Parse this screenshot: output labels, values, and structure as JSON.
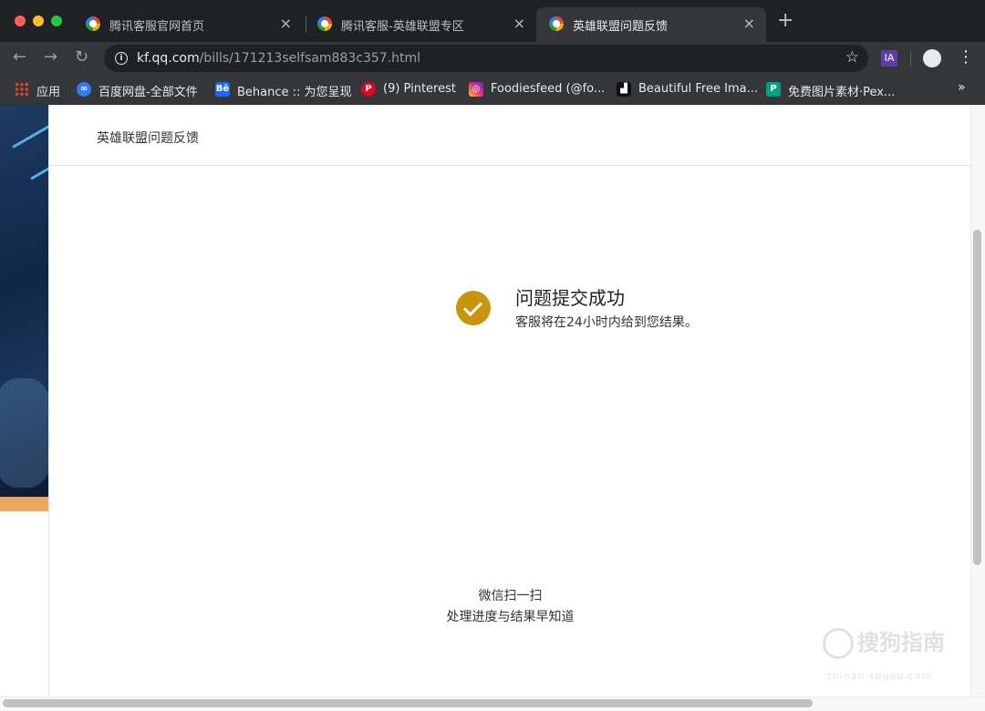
{
  "tabs": [
    {
      "title": "腾讯客服官网首页",
      "active": false
    },
    {
      "title": "腾讯客服-英雄联盟专区",
      "active": false
    },
    {
      "title": "英雄联盟问题反馈",
      "active": true
    }
  ],
  "tab_close_glyph": "×",
  "new_tab_glyph": "+",
  "toolbar": {
    "back_glyph": "←",
    "forward_glyph": "→",
    "reload_glyph": "↻",
    "url_host": "kf.qq.com",
    "url_path": "/bills/171213selfsam883c357.html",
    "star_glyph": "☆",
    "extension_label": "IA",
    "menu_glyph": "⋮"
  },
  "bookmarks": [
    {
      "label": "应用",
      "icon": "apps-grid-icon"
    },
    {
      "label": "百度网盘-全部文件",
      "icon": "baidu-pan-icon",
      "color": "#2f7cf6"
    },
    {
      "label": "Behance :: 为您呈现",
      "icon": "behance-icon",
      "color": "#1769ff",
      "glyph": "Bē"
    },
    {
      "label": "(9) Pinterest",
      "icon": "pinterest-icon",
      "color": "#e60023",
      "glyph": "P"
    },
    {
      "label": "Foodiesfeed (@fo...",
      "icon": "instagram-icon",
      "color": "#d6249f",
      "glyph": "◎"
    },
    {
      "label": "Beautiful Free Ima...",
      "icon": "unsplash-icon",
      "color": "#111111",
      "glyph": "▟"
    },
    {
      "label": "免费图片素材·Pex...",
      "icon": "pexels-icon",
      "color": "#05a081",
      "glyph": "P"
    }
  ],
  "bookmarks_more": "»",
  "page": {
    "header_title": "英雄联盟问题反馈",
    "success_title": "问题提交成功",
    "success_desc": "客服将在24小时内给到您结果。",
    "wechat_line1": "微信扫一扫",
    "wechat_line2": "处理进度与结果早知道",
    "success_color": "#c8940c"
  },
  "watermark": {
    "text": "搜狗指南",
    "sub": "zhinan.sogou.com"
  }
}
